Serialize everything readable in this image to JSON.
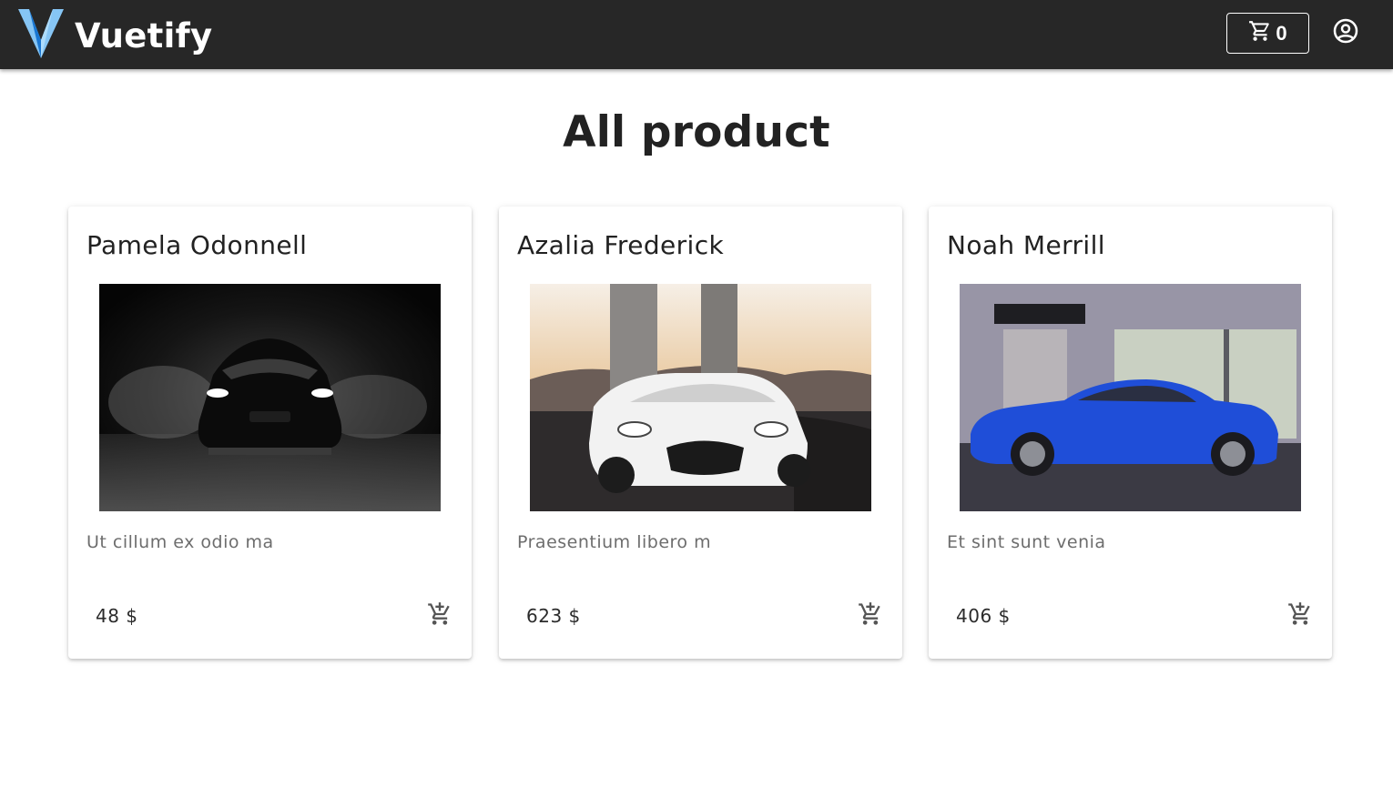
{
  "app": {
    "brand": "Vuetify"
  },
  "header": {
    "cart_count": "0"
  },
  "main": {
    "title": "All product"
  },
  "products": [
    {
      "name": "Pamela Odonnell",
      "description": "Ut cillum ex odio ma",
      "price": "48 $"
    },
    {
      "name": "Azalia Frederick",
      "description": "Praesentium libero m",
      "price": "623 $"
    },
    {
      "name": "Noah Merrill",
      "description": "Et sint sunt venia",
      "price": "406 $"
    }
  ],
  "colors": {
    "appbar": "#272727",
    "text": "#222222",
    "muted": "#6d6d6d",
    "logo_light": "#86c5f4",
    "logo_dark": "#1976d2"
  }
}
